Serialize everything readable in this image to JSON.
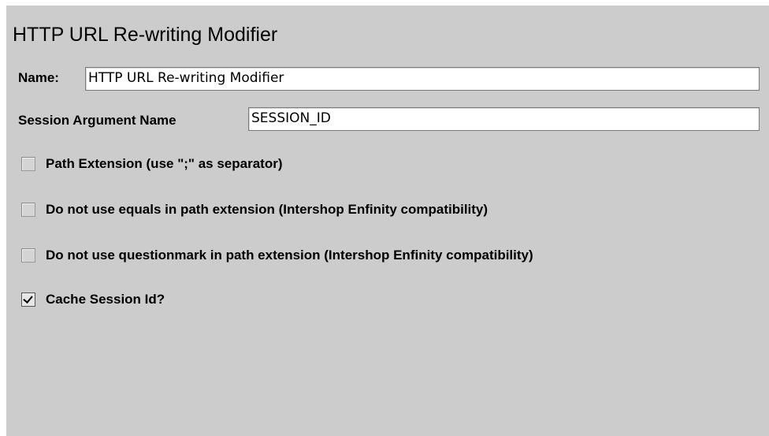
{
  "title": "HTTP URL Re-writing Modifier",
  "name_field": {
    "label": "Name:",
    "value": "HTTP URL Re-writing Modifier"
  },
  "session_arg_field": {
    "label": "Session Argument Name",
    "value": "SESSION_ID"
  },
  "options": [
    {
      "label": "Path Extension (use \";\" as separator)",
      "checked": false
    },
    {
      "label": "Do not use equals in path extension (Intershop Enfinity compatibility)",
      "checked": false
    },
    {
      "label": "Do not use questionmark in path extension (Intershop Enfinity compatibility)",
      "checked": false
    },
    {
      "label": "Cache Session Id?",
      "checked": true
    }
  ]
}
